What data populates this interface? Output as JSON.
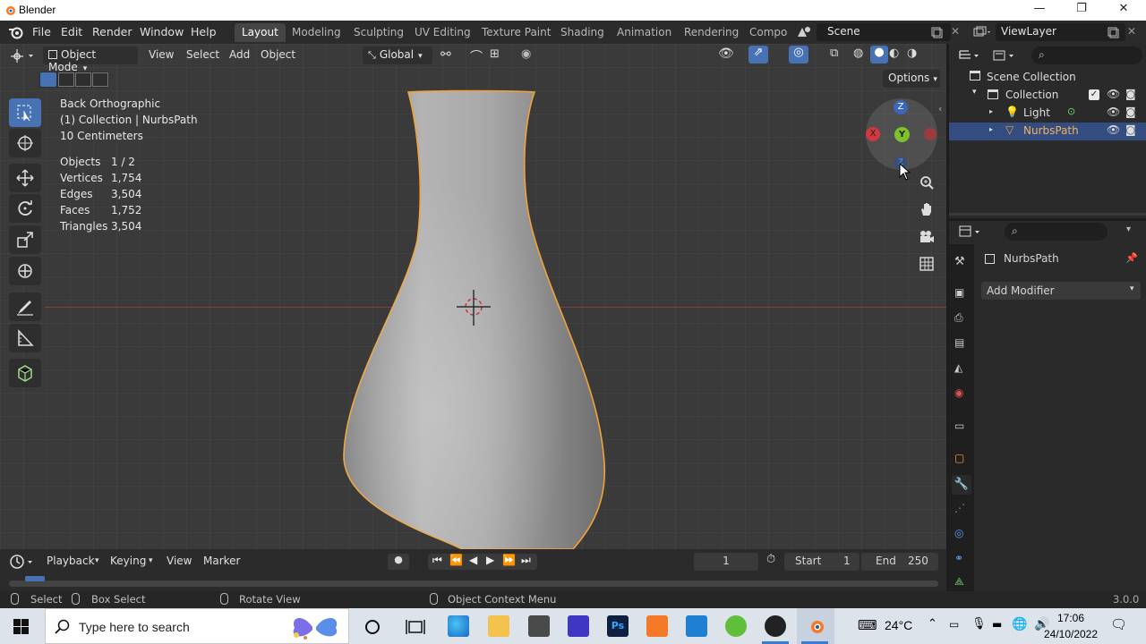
{
  "window": {
    "title": "Blender",
    "minimize": "—",
    "maximize": "❐",
    "close": "✕"
  },
  "menubar": {
    "items": [
      "File",
      "Edit",
      "Render",
      "Window",
      "Help"
    ]
  },
  "workspaces": [
    "Layout",
    "Modeling",
    "Sculpting",
    "UV Editing",
    "Texture Paint",
    "Shading",
    "Animation",
    "Rendering",
    "Compo"
  ],
  "scene": {
    "name": "Scene",
    "view_layer": "ViewLayer"
  },
  "viewport_header": {
    "mode": "Object Mode",
    "menus": [
      "View",
      "Select",
      "Add",
      "Object"
    ],
    "orientation": "Global",
    "options_label": "Options"
  },
  "viewport_info": {
    "view": "Back Orthographic",
    "collection": "(1) Collection | NurbsPath",
    "scale": "10 Centimeters",
    "stats": [
      {
        "label": "Objects",
        "value": "1 / 2"
      },
      {
        "label": "Vertices",
        "value": "1,754"
      },
      {
        "label": "Edges",
        "value": "3,504"
      },
      {
        "label": "Faces",
        "value": "1,752"
      },
      {
        "label": "Triangles",
        "value": "3,504"
      }
    ]
  },
  "gizmo": {
    "z_top": "Z",
    "x": "X",
    "y": "Y",
    "z_bottom": "Z"
  },
  "outliner": {
    "root": "Scene Collection",
    "collection": "Collection",
    "items": [
      "Light",
      "NurbsPath"
    ]
  },
  "properties": {
    "object_name": "NurbsPath",
    "add_modifier": "Add Modifier"
  },
  "timeline": {
    "menus": [
      "Playback",
      "Keying",
      "View",
      "Marker"
    ],
    "current_frame": "1",
    "start_label": "Start",
    "start": "1",
    "end_label": "End",
    "end": "250"
  },
  "statusbar": {
    "select": "Select",
    "box_select": "Box Select",
    "rotate": "Rotate View",
    "context": "Object Context Menu",
    "version": "3.0.0"
  },
  "taskbar": {
    "search_placeholder": "Type here to search",
    "temperature": "24°C",
    "time": "17:06",
    "date": "24/10/2022"
  },
  "colors": {
    "accent": "#4772b3",
    "selection": "#334d80",
    "outline": "#f0a33a"
  }
}
